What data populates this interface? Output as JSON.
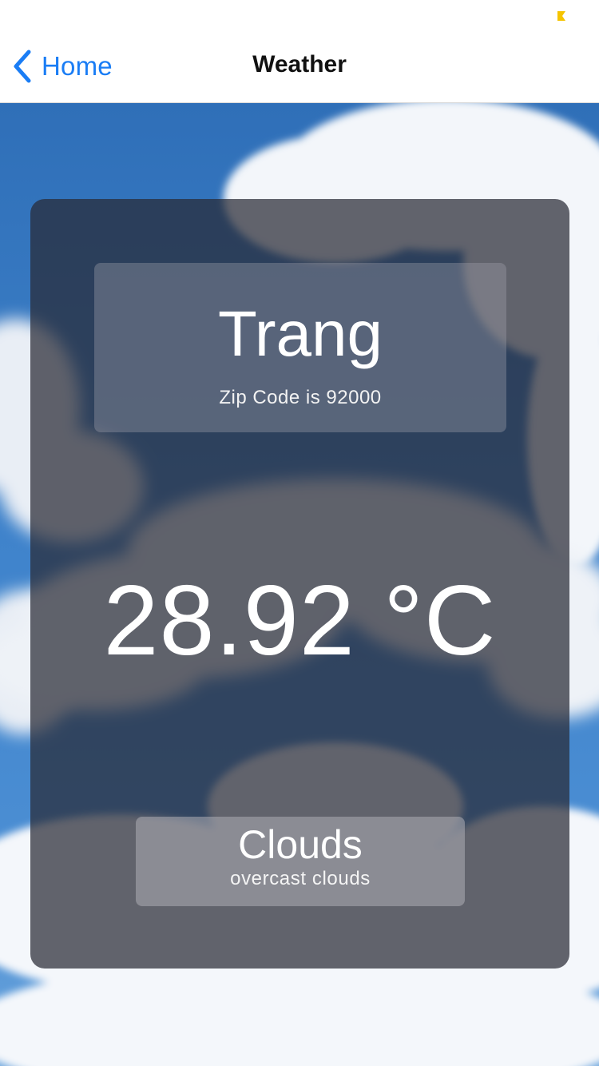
{
  "status_bar": {
    "indicator_color": "#f5c400"
  },
  "nav": {
    "back_label": "Home",
    "title": "Weather",
    "accent_color": "#1a7df5"
  },
  "weather": {
    "city": "Trang",
    "zip_text": "Zip Code is 92000",
    "temperature": "28.92 °C",
    "condition": "Clouds",
    "description": "overcast clouds"
  },
  "icons": {
    "back": "chevron-left-icon",
    "status": "status-indicator-icon"
  }
}
